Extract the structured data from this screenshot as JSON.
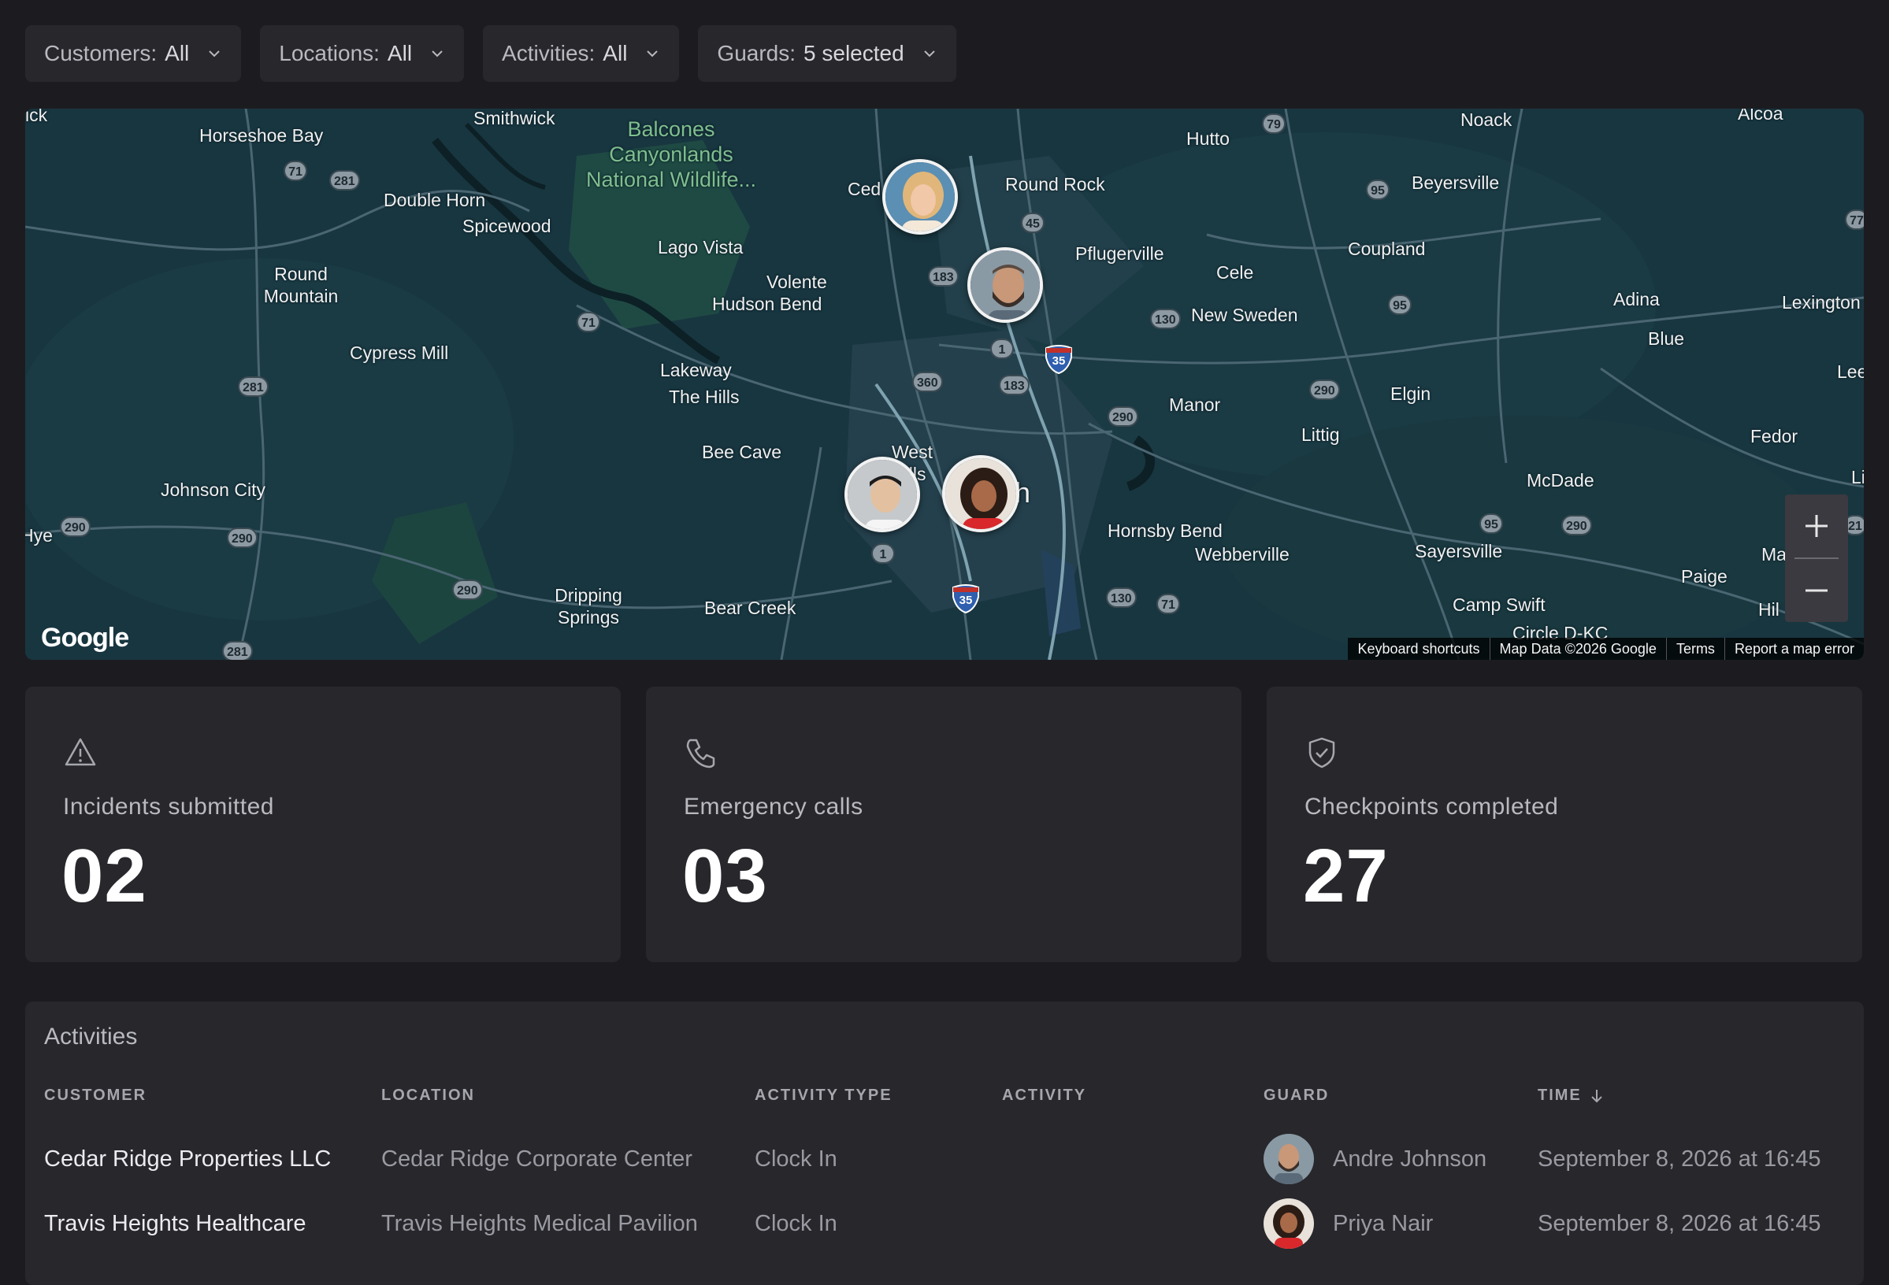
{
  "filters": [
    {
      "label": "Customers:",
      "value": "All"
    },
    {
      "label": "Locations:",
      "value": "All"
    },
    {
      "label": "Activities:",
      "value": "All"
    },
    {
      "label": "Guards:",
      "value": "5 selected"
    }
  ],
  "map": {
    "places": {
      "horseshoe_bay": "Horseshoe Bay",
      "smithwick": "Smithwick",
      "balcones": "Balcones Canyonlands National Wildlife...",
      "double_horn": "Double Horn",
      "spicewood": "Spicewood",
      "round_mountain": "Round Mountain",
      "cypress_mill": "Cypress Mill",
      "lago_vista": "Lago Vista",
      "volente": "Volente",
      "hudson_bend": "Hudson Bend",
      "lakeway": "Lakeway",
      "the_hills": "The Hills",
      "bee_cave": "Bee Cave",
      "west_hills": "West Hills",
      "johnson_city": "Johnson City",
      "hye": "Hye",
      "dripping_springs": "Dripping Springs",
      "bear_creek": "Bear Creek",
      "cedar": "Ced",
      "round_rock": "Round Rock",
      "hutto": "Hutto",
      "pflugerville": "Pflugerville",
      "cele": "Cele",
      "new_sweden": "New Sweden",
      "manor": "Manor",
      "littig": "Littig",
      "elgin": "Elgin",
      "coupland": "Coupland",
      "noack": "Noack",
      "beyersville": "Beyersville",
      "adina": "Adina",
      "blue": "Blue",
      "lexington": "Lexington",
      "lee": "Lee",
      "fedor": "Fedor",
      "mcdade": "McDade",
      "hornsby_bend": "Hornsby Bend",
      "webberville": "Webberville",
      "sayersville": "Sayersville",
      "paige": "Paige",
      "camp_swift": "Camp Swift",
      "circle_dkc": "Circle D-KC",
      "alcoa": "Alcoa",
      "ma": "Ma",
      "hil": "Hil",
      "li": "Li",
      "ick": "ick",
      "austin_fragment": "h"
    },
    "route_labels": {
      "r71a": "71",
      "r281a": "281",
      "r71b": "71",
      "r281b": "281",
      "r290a": "290",
      "r290b": "290",
      "r290c": "290",
      "r281c": "281",
      "r183a": "183",
      "r45": "45",
      "r1a": "1",
      "r360": "360",
      "r183b": "183",
      "r1b": "1",
      "r130a": "130",
      "r290d": "290",
      "r290e": "290",
      "r95a": "95",
      "r95b": "95",
      "r79": "79",
      "r77": "77",
      "r95c": "95",
      "r290f": "290",
      "r130b": "130",
      "r71c": "71",
      "r21": "21",
      "i35a": "35",
      "i35b": "35"
    },
    "google_logo": "Google",
    "attribution": [
      "Keyboard shortcuts",
      "Map Data ©2026 Google",
      "Terms",
      "Report a map error"
    ],
    "zoom_in": "+",
    "zoom_out": "−"
  },
  "stats": [
    {
      "label": "Incidents submitted",
      "value": "02",
      "icon": "warning-triangle-icon"
    },
    {
      "label": "Emergency calls",
      "value": "03",
      "icon": "phone-icon"
    },
    {
      "label": "Checkpoints completed",
      "value": "27",
      "icon": "shield-check-icon"
    }
  ],
  "activities": {
    "title": "Activities",
    "columns": {
      "customer": "CUSTOMER",
      "location": "LOCATION",
      "activity_type": "ACTIVITY TYPE",
      "activity": "ACTIVITY",
      "guard": "GUARD",
      "time": "TIME"
    },
    "rows": [
      {
        "customer": "Cedar Ridge Properties LLC",
        "location": "Cedar Ridge Corporate Center",
        "activity_type": "Clock In",
        "activity": "",
        "guard": "Andre Johnson",
        "time": "September 8, 2026 at 16:45"
      },
      {
        "customer": "Travis Heights Healthcare",
        "location": "Travis Heights Medical Pavilion",
        "activity_type": "Clock In",
        "activity": "",
        "guard": "Priya Nair",
        "time": "September 8, 2026 at 16:45"
      }
    ]
  },
  "colors": {
    "background": "#1c1c20",
    "card": "#27272c",
    "map_water": "#16303a",
    "map_park": "#1f4a44"
  }
}
